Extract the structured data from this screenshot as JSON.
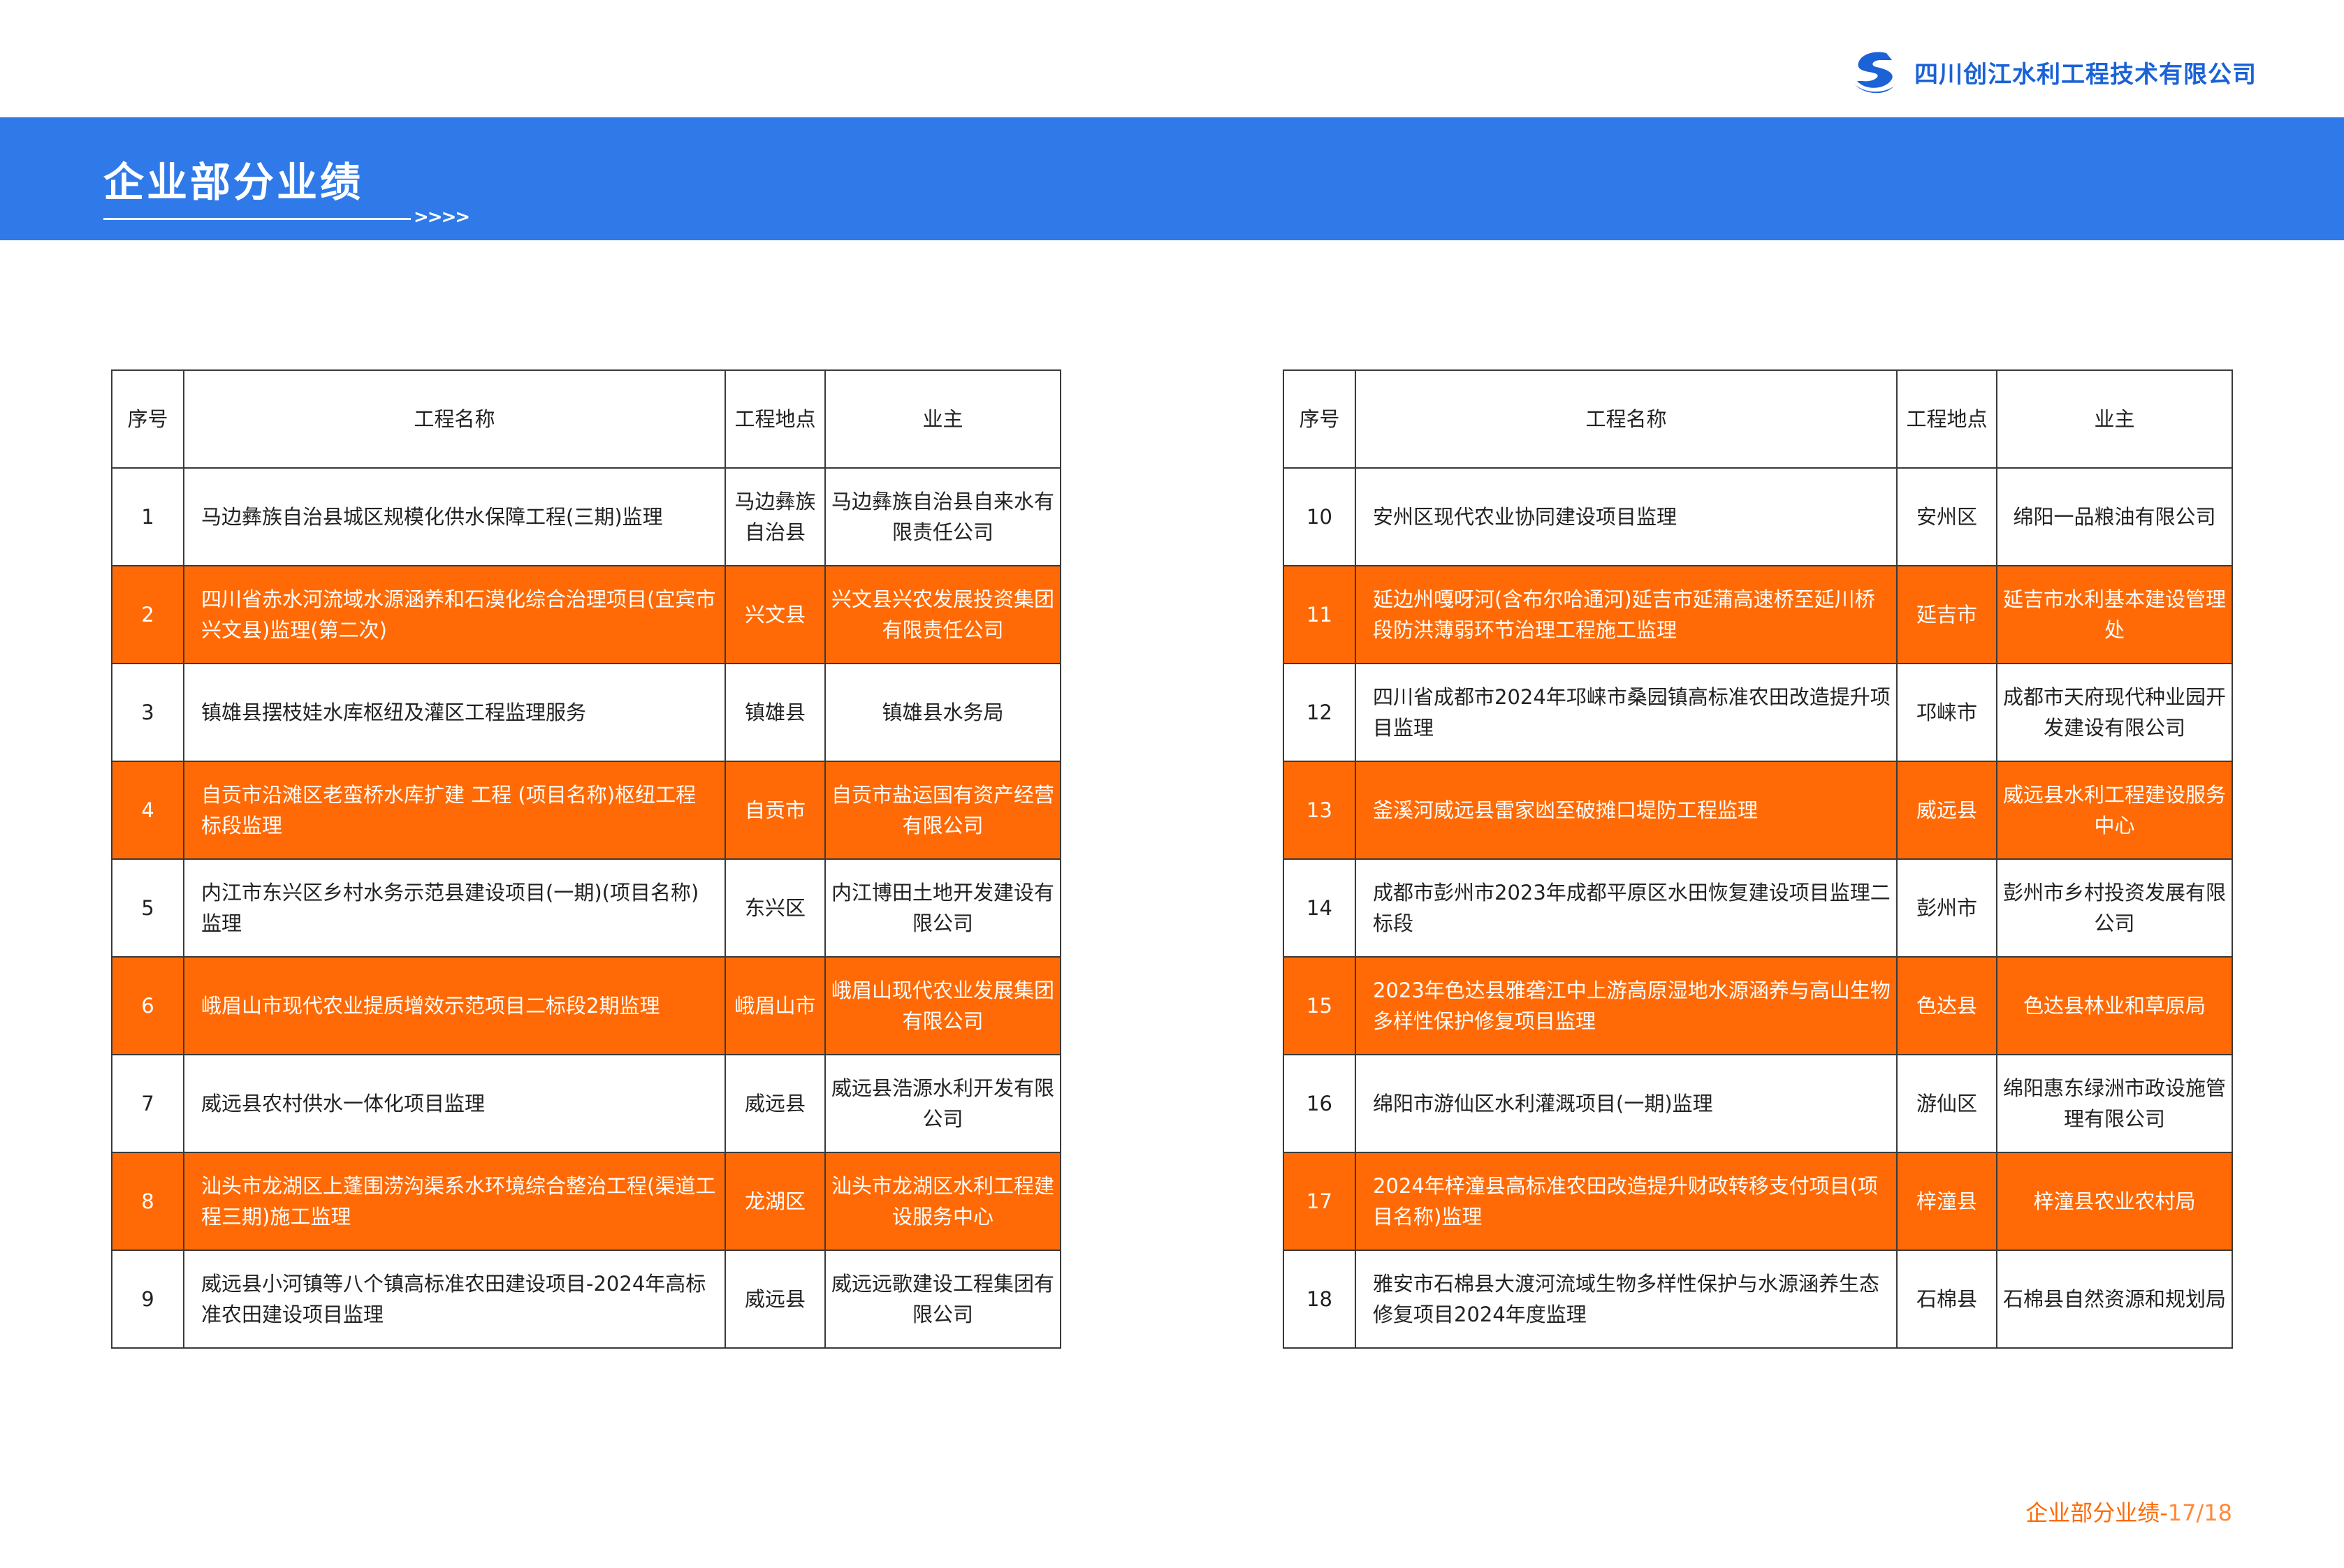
{
  "header": {
    "company_name": "四川创江水利工程技术有限公司"
  },
  "banner": {
    "title": "企业部分业绩",
    "arrows": ">>>>"
  },
  "columns": {
    "no": "序号",
    "name": "工程名称",
    "location": "工程地点",
    "owner": "业主"
  },
  "left_rows": [
    {
      "no": "1",
      "name": "马边彝族自治县城区规模化供水保障工程(三期)监理",
      "location": "马边彝族自治县",
      "owner": "马边彝族自治县自来水有限责任公司"
    },
    {
      "no": "2",
      "name": "四川省赤水河流域水源涵养和石漠化综合治理项目(宜宾市兴文县)监理(第二次)",
      "location": "兴文县",
      "owner": "兴文县兴农发展投资集团有限责任公司"
    },
    {
      "no": "3",
      "name": "镇雄县摆枝娃水库枢纽及灌区工程监理服务",
      "location": "镇雄县",
      "owner": "镇雄县水务局"
    },
    {
      "no": "4",
      "name": "自贡市沿滩区老蛮桥水库扩建 工程 (项目名称)枢纽工程 标段监理",
      "location": "自贡市",
      "owner": "自贡市盐运国有资产经营有限公司"
    },
    {
      "no": "5",
      "name": "内江市东兴区乡村水务示范县建设项目(一期)(项目名称)监理",
      "location": "东兴区",
      "owner": "内江博田土地开发建设有限公司"
    },
    {
      "no": "6",
      "name": "峨眉山市现代农业提质增效示范项目二标段2期监理",
      "location": "峨眉山市",
      "owner": "峨眉山现代农业发展集团有限公司"
    },
    {
      "no": "7",
      "name": "威远县农村供水一体化项目监理",
      "location": "威远县",
      "owner": "威远县浩源水利开发有限公司"
    },
    {
      "no": "8",
      "name": "汕头市龙湖区上蓬围涝沟渠系水环境综合整治工程(渠道工程三期)施工监理",
      "location": "龙湖区",
      "owner": "汕头市龙湖区水利工程建设服务中心"
    },
    {
      "no": "9",
      "name": "威远县小河镇等八个镇高标准农田建设项目-2024年高标准农田建设项目监理",
      "location": "威远县",
      "owner": "威远远歌建设工程集团有限公司"
    }
  ],
  "right_rows": [
    {
      "no": "10",
      "name": "安州区现代农业协同建设项目监理",
      "location": "安州区",
      "owner": "绵阳一品粮油有限公司"
    },
    {
      "no": "11",
      "name": "延边州嘎呀河(含布尔哈通河)延吉市延蒲高速桥至延川桥段防洪薄弱环节治理工程施工监理",
      "location": "延吉市",
      "owner": "延吉市水利基本建设管理处"
    },
    {
      "no": "12",
      "name": "四川省成都市2024年邛崃市桑园镇高标准农田改造提升项目监理",
      "location": "邛崃市",
      "owner": "成都市天府现代种业园开发建设有限公司"
    },
    {
      "no": "13",
      "name": "釜溪河威远县雷家凼至破摊口堤防工程监理",
      "location": "威远县",
      "owner": "威远县水利工程建设服务中心"
    },
    {
      "no": "14",
      "name": "成都市彭州市2023年成都平原区水田恢复建设项目监理二标段",
      "location": "彭州市",
      "owner": "彭州市乡村投资发展有限公司"
    },
    {
      "no": "15",
      "name": "2023年色达县雅砻江中上游高原湿地水源涵养与高山生物多样性保护修复项目监理",
      "location": "色达县",
      "owner": "色达县林业和草原局"
    },
    {
      "no": "16",
      "name": "绵阳市游仙区水利灌溉项目(一期)监理",
      "location": "游仙区",
      "owner": "绵阳惠东绿洲市政设施管理有限公司"
    },
    {
      "no": "17",
      "name": "2024年梓潼县高标准农田改造提升财政转移支付项目(项目名称)监理",
      "location": "梓潼县",
      "owner": "梓潼县农业农村局"
    },
    {
      "no": "18",
      "name": "雅安市石棉县大渡河流域生物多样性保护与水源涵养生态修复项目2024年度监理",
      "location": "石棉县",
      "owner": "石棉县自然资源和规划局"
    }
  ],
  "footer": {
    "label": "企业部分业绩-",
    "page": "17/18"
  },
  "colors": {
    "accent_blue": "#2f7ae8",
    "highlight_orange": "#ff6a06"
  }
}
